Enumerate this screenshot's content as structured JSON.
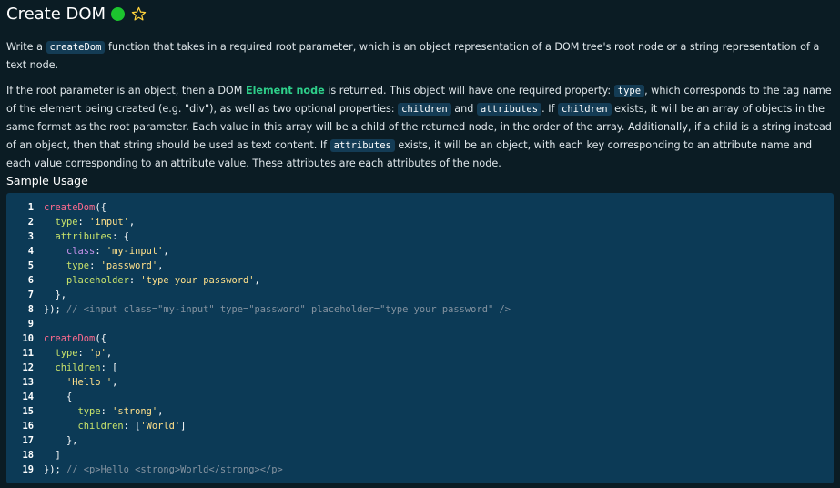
{
  "header": {
    "title": "Create DOM",
    "status_color": "#1cc42e"
  },
  "description": {
    "p1": {
      "t1": "Write a ",
      "code": "createDom",
      "t2": " function that takes in a required root parameter, which is an object representation of a DOM tree's root node or a string representation of a text node."
    },
    "p2": {
      "t1": "If the root parameter is an object, then a DOM ",
      "link": "Element node",
      "t2": " is returned. This object will have one required property: ",
      "code_type": "type",
      "t3": ", which corresponds to the tag name of the element being created (e.g. \"div\"), as well as two optional properties: ",
      "code_children": "children",
      "t4": " and ",
      "code_attributes": "attributes",
      "t5": ". If ",
      "code_children2": "children",
      "t6": " exists, it will be an array of objects in the same format as the root parameter. Each value in this array will be a child of the returned node, in the order of the array. Additionally, if a child is a string instead of an object, then that string should be used as text content. If ",
      "code_attributes2": "attributes",
      "t7": " exists, it will be an object, with each key corresponding to an attribute name and each value corresponding to an attribute value. These attributes are each attributes of the node."
    }
  },
  "sample": {
    "heading": "Sample Usage"
  },
  "code": {
    "lines": [
      {
        "n": "1",
        "tokens": [
          [
            "fn",
            "createDom"
          ],
          [
            "punc",
            "({"
          ]
        ]
      },
      {
        "n": "2",
        "tokens": [
          [
            "punc",
            "  "
          ],
          [
            "key",
            "type"
          ],
          [
            "punc",
            ": "
          ],
          [
            "str",
            "'input'"
          ],
          [
            "punc",
            ","
          ]
        ]
      },
      {
        "n": "3",
        "tokens": [
          [
            "punc",
            "  "
          ],
          [
            "key",
            "attributes"
          ],
          [
            "punc",
            ": {"
          ]
        ]
      },
      {
        "n": "4",
        "tokens": [
          [
            "punc",
            "    "
          ],
          [
            "cls",
            "class"
          ],
          [
            "punc",
            ": "
          ],
          [
            "str",
            "'my-input'"
          ],
          [
            "punc",
            ","
          ]
        ]
      },
      {
        "n": "5",
        "tokens": [
          [
            "punc",
            "    "
          ],
          [
            "key",
            "type"
          ],
          [
            "punc",
            ": "
          ],
          [
            "str",
            "'password'"
          ],
          [
            "punc",
            ","
          ]
        ]
      },
      {
        "n": "6",
        "tokens": [
          [
            "punc",
            "    "
          ],
          [
            "key",
            "placeholder"
          ],
          [
            "punc",
            ": "
          ],
          [
            "str",
            "'type your password'"
          ],
          [
            "punc",
            ","
          ]
        ]
      },
      {
        "n": "7",
        "tokens": [
          [
            "punc",
            "  },"
          ]
        ]
      },
      {
        "n": "8",
        "tokens": [
          [
            "punc",
            "}); "
          ],
          [
            "com",
            "// <input class=\"my-input\" type=\"password\" placeholder=\"type your password\" />"
          ]
        ]
      },
      {
        "n": "9",
        "tokens": []
      },
      {
        "n": "10",
        "tokens": [
          [
            "fn",
            "createDom"
          ],
          [
            "punc",
            "({"
          ]
        ]
      },
      {
        "n": "11",
        "tokens": [
          [
            "punc",
            "  "
          ],
          [
            "key",
            "type"
          ],
          [
            "punc",
            ": "
          ],
          [
            "str",
            "'p'"
          ],
          [
            "punc",
            ","
          ]
        ]
      },
      {
        "n": "12",
        "tokens": [
          [
            "punc",
            "  "
          ],
          [
            "key",
            "children"
          ],
          [
            "punc",
            ": ["
          ]
        ]
      },
      {
        "n": "13",
        "tokens": [
          [
            "punc",
            "    "
          ],
          [
            "str",
            "'Hello '"
          ],
          [
            "punc",
            ","
          ]
        ]
      },
      {
        "n": "14",
        "tokens": [
          [
            "punc",
            "    {"
          ]
        ]
      },
      {
        "n": "15",
        "tokens": [
          [
            "punc",
            "      "
          ],
          [
            "key",
            "type"
          ],
          [
            "punc",
            ": "
          ],
          [
            "str",
            "'strong'"
          ],
          [
            "punc",
            ","
          ]
        ]
      },
      {
        "n": "16",
        "tokens": [
          [
            "punc",
            "      "
          ],
          [
            "key",
            "children"
          ],
          [
            "punc",
            ": ["
          ],
          [
            "str",
            "'World'"
          ],
          [
            "punc",
            "]"
          ]
        ]
      },
      {
        "n": "17",
        "tokens": [
          [
            "punc",
            "    },"
          ]
        ]
      },
      {
        "n": "18",
        "tokens": [
          [
            "punc",
            "  ]"
          ]
        ]
      },
      {
        "n": "19",
        "tokens": [
          [
            "punc",
            "}); "
          ],
          [
            "com",
            "// <p>Hello <strong>World</strong></p>"
          ]
        ]
      }
    ]
  }
}
